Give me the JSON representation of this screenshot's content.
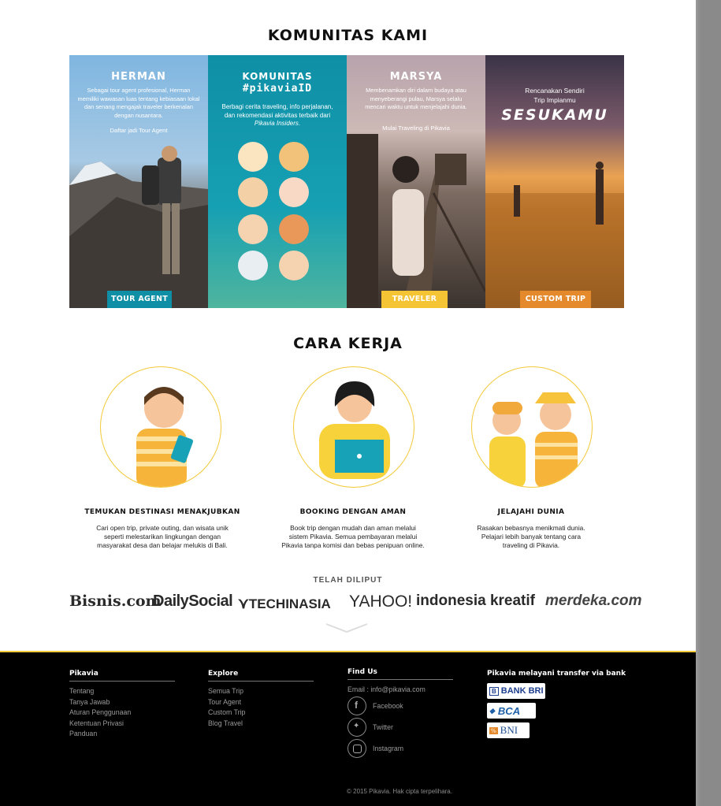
{
  "community": {
    "title": "KOMUNITAS KAMI",
    "cards": [
      {
        "name": "HERMAN",
        "desc": "Sebagai tour agent profesional, Herman memiliki wawasan luas tentang kebiasaan lokal dan senang mengajak traveler berkenalan dengan nusantara.",
        "link": "Daftar jadi Tour Agent",
        "tag": "TOUR AGENT",
        "tag_color": "#0f8fa6"
      },
      {
        "name": "KOMUNITAS",
        "name2": "#pikaviaID",
        "desc_a": "Berbagi cerita traveling, info perjalanan, dan rekomendasi aktivitas terbaik dari ",
        "desc_b": "Pikavia Insiders",
        "desc_c": "."
      },
      {
        "name": "MARSYA",
        "desc": "Membenamkan diri dalam budaya atau menyeberangi pulau, Marsya selalu mencari waktu untuk menjelajahi dunia.",
        "link": "Mulai Traveling di Pikavia",
        "tag": "TRAVELER",
        "tag_color": "#f5c435"
      },
      {
        "line1": "Rencanakan Sendiri",
        "line2": "Trip Impianmu",
        "script": "SESUKAMU",
        "tag": "CUSTOM TRIP",
        "tag_color": "#e58a2c"
      }
    ]
  },
  "how": {
    "title": "CARA KERJA",
    "steps": [
      {
        "title": "TEMUKAN DESTINASI MENAKJUBKAN",
        "l1": "Cari open trip, private outing, dan wisata unik",
        "l2": "seperti melestarikan lingkungan dengan",
        "l3": "masyarakat desa dan belajar melukis di Bali."
      },
      {
        "title": "BOOKING DENGAN AMAN",
        "l1": "Book trip dengan mudah dan aman melalui",
        "l2": "sistem  Pikavia. Semua pembayaran melalui",
        "l3": "Pikavia tanpa komisi dan bebas penipuan online."
      },
      {
        "title": "JELAJAHI DUNIA",
        "l1": "Rasakan bebasnya menikmati dunia.",
        "l2": "Pelajari lebih banyak tentang cara",
        "l3": "traveling di Pikavia."
      }
    ]
  },
  "press": {
    "title": "TELAH DILIPUT",
    "logos": [
      "Bisnis.com",
      "DailySocial",
      "TECHINASIA",
      "YAHOO!",
      "indonesia kreatif",
      "merdeka.com"
    ]
  },
  "footer": {
    "pikavia": {
      "title": "Pikavia",
      "links": [
        "Tentang",
        "Tanya Jawab",
        "Aturan Penggunaan",
        "Ketentuan Privasi",
        "Panduan"
      ]
    },
    "explore": {
      "title": "Explore",
      "links": [
        "Semua Trip",
        "Tour Agent",
        "Custom Trip",
        "Blog Travel"
      ]
    },
    "findus": {
      "title": "Find Us",
      "email": "Email : info@pikavia.com",
      "social": [
        "Facebook",
        "Twitter",
        "Instagram"
      ]
    },
    "banks": {
      "title": "Pikavia melayani transfer via bank",
      "list": [
        "BANK BRI",
        "BCA",
        "BNI"
      ]
    },
    "copyright": "2015 Pikavia. Hak cipta terpelihara."
  },
  "colors": {
    "accent": "#f3c93a",
    "teal": "#0f8fa6",
    "orange": "#e58a2c"
  }
}
